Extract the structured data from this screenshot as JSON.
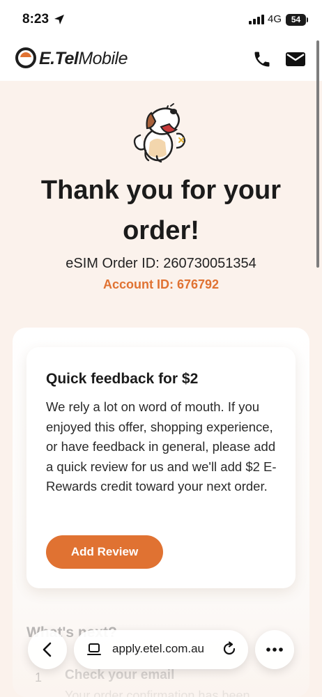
{
  "status_bar": {
    "time": "8:23",
    "network": "4G",
    "battery": "54"
  },
  "header": {
    "brand_bold": "E.Tel",
    "brand_regular": "Mobile",
    "brand_color": "#e07232"
  },
  "hero": {
    "title": "Thank you for your order!",
    "order_id": "eSIM Order ID: 260730051354",
    "account_id": "Account ID: 676792"
  },
  "feedback": {
    "title": "Quick feedback for $2",
    "body": "We rely a lot on word of mouth. If you enjoyed this offer, shopping experience, or have feedback in general, please add a quick review for us and we'll add $2 E-Rewards credit toward your next order.",
    "button_label": "Add Review"
  },
  "next_steps": {
    "heading": "What's next?",
    "steps": [
      {
        "number": "1",
        "title": "Check your email",
        "description": "Your order confirmation has been"
      }
    ]
  },
  "browser": {
    "url": "apply.etel.com.au"
  },
  "icons": {
    "location": "location-arrow-icon",
    "phone": "phone-icon",
    "mail": "mail-icon",
    "back": "chevron-left-icon",
    "page": "page-icon",
    "reload": "reload-icon",
    "more": "more-icon"
  }
}
